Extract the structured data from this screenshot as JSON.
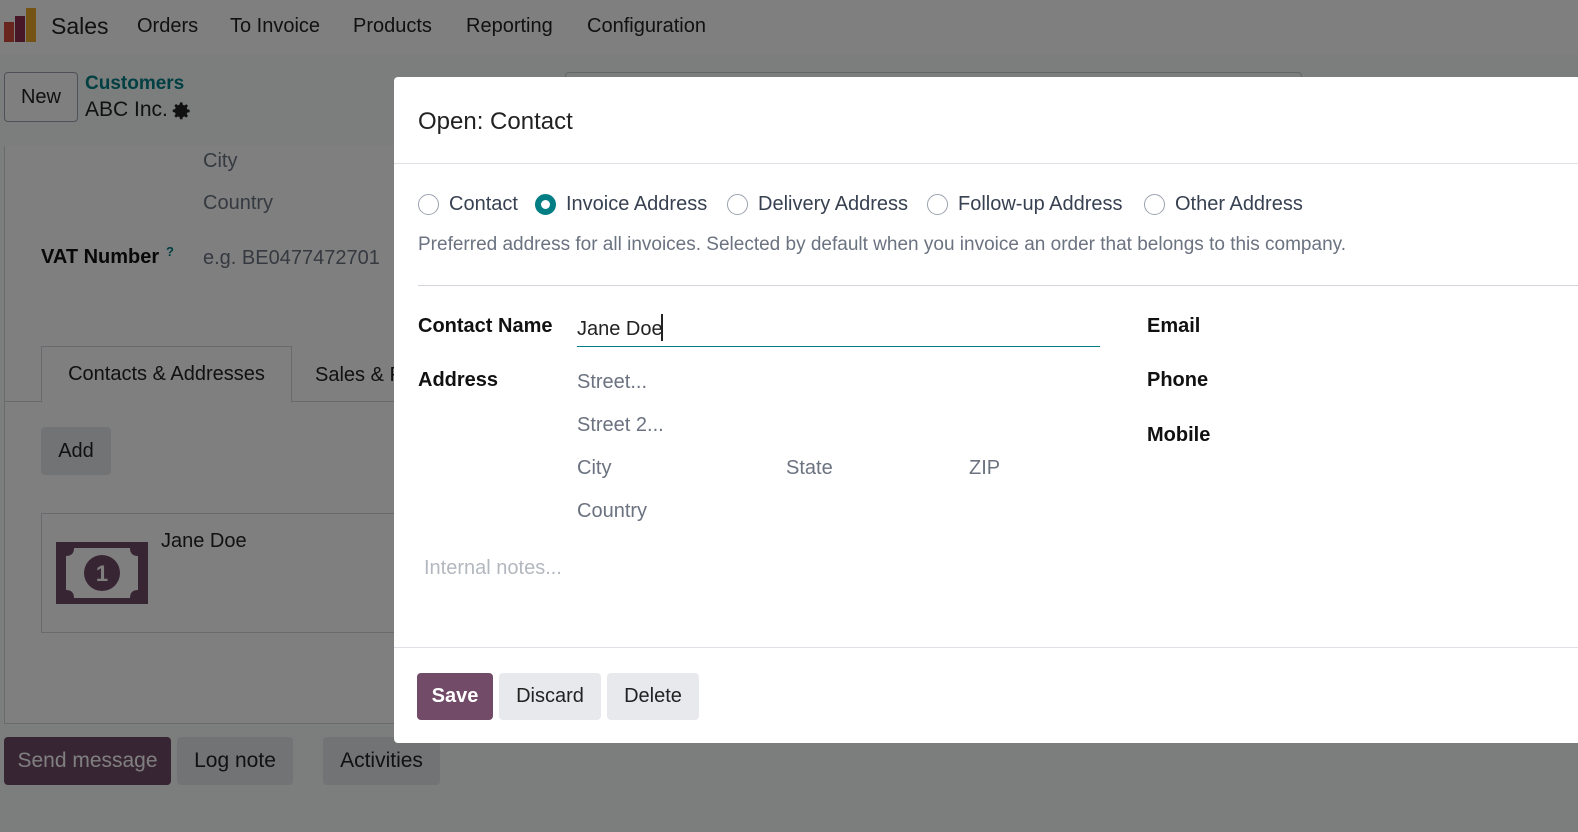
{
  "app": {
    "name": "Sales",
    "nav": [
      "Orders",
      "To Invoice",
      "Products",
      "Reporting",
      "Configuration"
    ]
  },
  "control_panel": {
    "new_label": "New",
    "breadcrumb_parent": "Customers",
    "record_name": "ABC Inc."
  },
  "background_form": {
    "city_placeholder": "City",
    "country_placeholder": "Country",
    "vat_label": "VAT Number",
    "vat_help": "?",
    "vat_placeholder": "e.g. BE0477472701",
    "tabs": [
      "Contacts & Addresses",
      "Sales & P"
    ],
    "add_label": "Add",
    "contact_card_name": "Jane Doe"
  },
  "chatter": {
    "send_message": "Send message",
    "log_note": "Log note",
    "activities": "Activities"
  },
  "modal": {
    "title": "Open: Contact",
    "address_types": [
      {
        "label": "Contact",
        "checked": false
      },
      {
        "label": "Invoice Address",
        "checked": true
      },
      {
        "label": "Delivery Address",
        "checked": false
      },
      {
        "label": "Follow-up Address",
        "checked": false
      },
      {
        "label": "Other Address",
        "checked": false
      }
    ],
    "type_help": "Preferred address for all invoices. Selected by default when you invoice an order that belongs to this company.",
    "contact_name_label": "Contact Name",
    "contact_name_value": "Jane Doe",
    "address_label": "Address",
    "street_placeholder": "Street...",
    "street2_placeholder": "Street 2...",
    "city_placeholder": "City",
    "state_placeholder": "State",
    "zip_placeholder": "ZIP",
    "country_placeholder": "Country",
    "email_label": "Email",
    "phone_label": "Phone",
    "mobile_label": "Mobile",
    "notes_placeholder": "Internal notes...",
    "save_label": "Save",
    "discard_label": "Discard",
    "delete_label": "Delete"
  },
  "colors": {
    "primary": "#714b67",
    "accent": "#017e84"
  }
}
